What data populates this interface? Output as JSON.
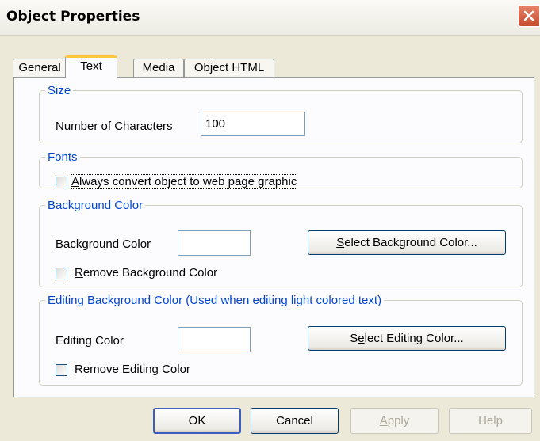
{
  "window": {
    "title": "Object Properties"
  },
  "tabs": [
    {
      "label": "General",
      "active": false
    },
    {
      "label": "Text",
      "active": true
    },
    {
      "label": "Media",
      "active": false
    },
    {
      "label": "Object HTML",
      "active": false
    }
  ],
  "size_group": {
    "legend": "Size",
    "chars_label": "Number of Characters",
    "chars_value": "100"
  },
  "fonts_group": {
    "legend": "Fonts",
    "convert_check": {
      "accel": "A",
      "rest": "lways convert object to web page graphic",
      "checked": false
    }
  },
  "background_group": {
    "legend": "Background Color",
    "color_label": "Background Color",
    "select_button": {
      "accel": "S",
      "rest": "elect Background Color..."
    },
    "remove_check": {
      "accel": "R",
      "rest": "emove Background Color",
      "checked": false
    }
  },
  "editing_group": {
    "legend": "Editing Background Color  (Used when editing light colored text)",
    "color_label": "Editing Color",
    "select_button": {
      "pre": "S",
      "accel": "e",
      "rest": "lect Editing Color..."
    },
    "remove_check": {
      "accel": "R",
      "rest": "emove Editing Color",
      "checked": false
    }
  },
  "footer": {
    "ok": "OK",
    "cancel": "Cancel",
    "apply": {
      "accel": "A",
      "rest": "pply",
      "enabled": false
    },
    "help": {
      "label": "Help",
      "enabled": false
    }
  },
  "colors": {
    "accent_tab": "#ffc83c",
    "legend_text": "#0046d5",
    "close_button": "#c64a2d"
  }
}
